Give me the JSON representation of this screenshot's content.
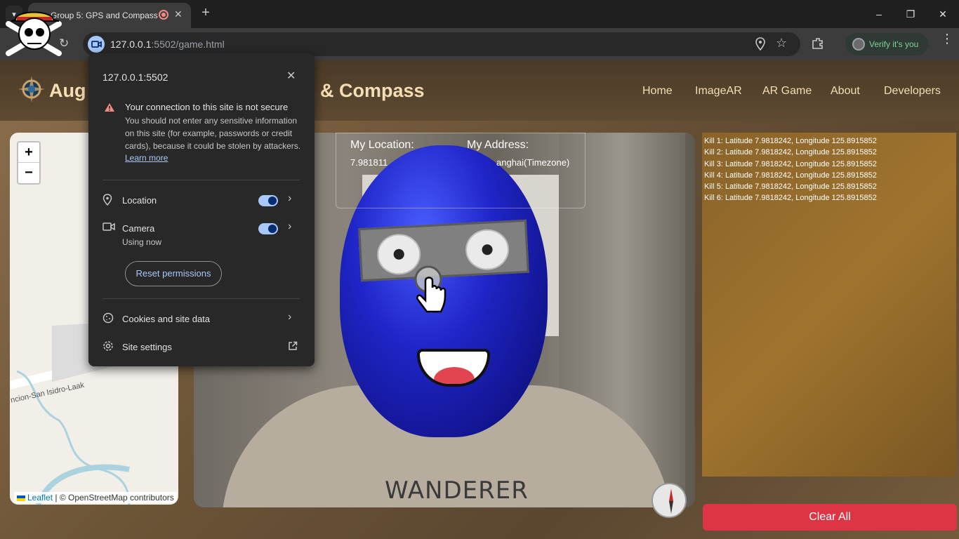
{
  "browser": {
    "tab_title": "Group 5: GPS and Compass",
    "tab_close": "✕",
    "new_tab": "+",
    "url_host": "127.0.0.1",
    "url_rest": ":5502/game.html",
    "verify_text": "Verify it's you",
    "window_controls": [
      "–",
      "❐",
      "✕"
    ]
  },
  "navbar": {
    "brand_left": "Aug",
    "brand_right": "& Compass",
    "links": [
      "Home",
      "ImageAR",
      "AR Game",
      "About",
      "Developers"
    ]
  },
  "map": {
    "zoom_in": "+",
    "zoom_out": "−",
    "road_label": "ncion-San Isidro-Laak",
    "attribution_link": "Leaflet",
    "attribution_text": " | © OpenStreetMap contributors"
  },
  "location": {
    "my_location_label": "My Location:",
    "my_location_value": "7.981811",
    "my_address_label": "My Address:",
    "my_address_value": "anghai(Timezone)"
  },
  "camera": {
    "shirt_text": "WANDERER"
  },
  "kills": [
    "Kill 1: Latitude 7.9818242, Longitude 125.8915852",
    "Kill 2: Latitude 7.9818242, Longitude 125.8915852",
    "Kill 3: Latitude 7.9818242, Longitude 125.8915852",
    "Kill 4: Latitude 7.9818242, Longitude 125.8915852",
    "Kill 5: Latitude 7.9818242, Longitude 125.8915852",
    "Kill 6: Latitude 7.9818242, Longitude 125.8915852"
  ],
  "clear_button": "Clear All",
  "site_popup": {
    "title": "127.0.0.1:5502",
    "close": "✕",
    "warning_title": "Your connection to this site is not secure",
    "warning_body": "You should not enter any sensitive information on this site (for example, passwords or credit cards), because it could be stolen by attackers.",
    "learn_more": "Learn more",
    "location_label": "Location",
    "location_enabled": true,
    "camera_label": "Camera",
    "camera_sub": "Using now",
    "camera_enabled": true,
    "reset_permissions": "Reset permissions",
    "cookies_label": "Cookies and site data",
    "site_settings_label": "Site settings"
  },
  "colors": {
    "accent_blue": "#a8c7fa",
    "danger_red": "#dc3545",
    "brand_text": "#f5deb3",
    "verify_green": "#7fcf9c"
  }
}
